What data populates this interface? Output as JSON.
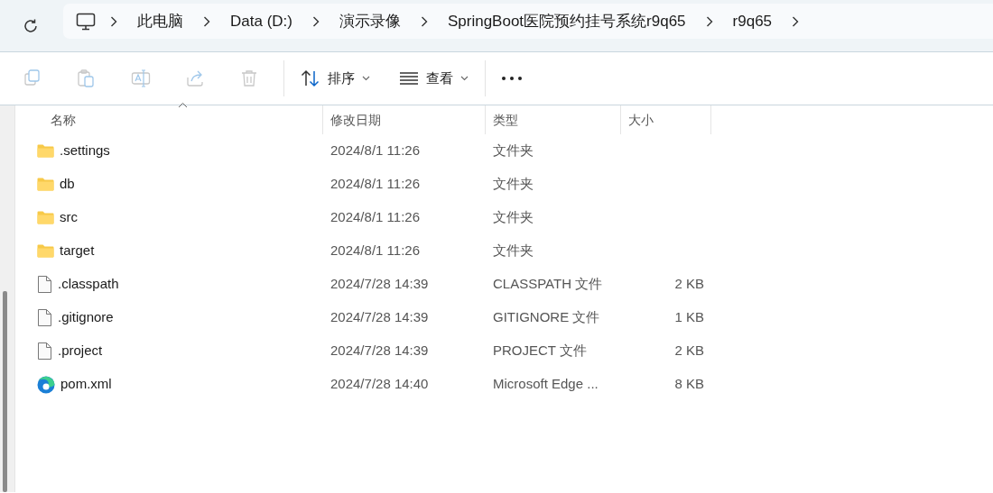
{
  "breadcrumbs": [
    {
      "label": "此电脑"
    },
    {
      "label": "Data (D:)"
    },
    {
      "label": "演示录像"
    },
    {
      "label": "SpringBoot医院预约挂号系统r9q65"
    },
    {
      "label": "r9q65"
    }
  ],
  "toolbar": {
    "actions": [
      {
        "kind": "copy",
        "disabled": true
      },
      {
        "kind": "paste",
        "disabled": true
      },
      {
        "kind": "rename",
        "disabled": true
      },
      {
        "kind": "share",
        "disabled": true
      },
      {
        "kind": "delete",
        "disabled": true
      }
    ],
    "sort": {
      "label": "排序"
    },
    "view": {
      "label": "查看"
    }
  },
  "columns": [
    {
      "label": "名称",
      "sorted": true
    },
    {
      "label": "修改日期",
      "sorted": false
    },
    {
      "label": "类型",
      "sorted": false
    },
    {
      "label": "大小",
      "sorted": false
    }
  ],
  "rows": [
    {
      "kind": "folder",
      "name": ".settings",
      "date": "2024/8/1 11:26",
      "type": "文件夹"
    },
    {
      "kind": "folder",
      "name": "db",
      "date": "2024/8/1 11:26",
      "type": "文件夹"
    },
    {
      "kind": "folder",
      "name": "src",
      "date": "2024/8/1 11:26",
      "type": "文件夹"
    },
    {
      "kind": "folder",
      "name": "target",
      "date": "2024/8/1 11:26",
      "type": "文件夹"
    },
    {
      "kind": "file",
      "name": ".classpath",
      "date": "2024/7/28 14:39",
      "type": "CLASSPATH 文件",
      "size": "2 KB"
    },
    {
      "kind": "file",
      "name": ".gitignore",
      "date": "2024/7/28 14:39",
      "type": "GITIGNORE 文件",
      "size": "1 KB"
    },
    {
      "kind": "file",
      "name": ".project",
      "date": "2024/7/28 14:39",
      "type": "PROJECT 文件",
      "size": "2 KB"
    },
    {
      "kind": "edge",
      "name": "pom.xml",
      "date": "2024/7/28 14:40",
      "type": "Microsoft Edge ...",
      "size": "8 KB"
    }
  ]
}
